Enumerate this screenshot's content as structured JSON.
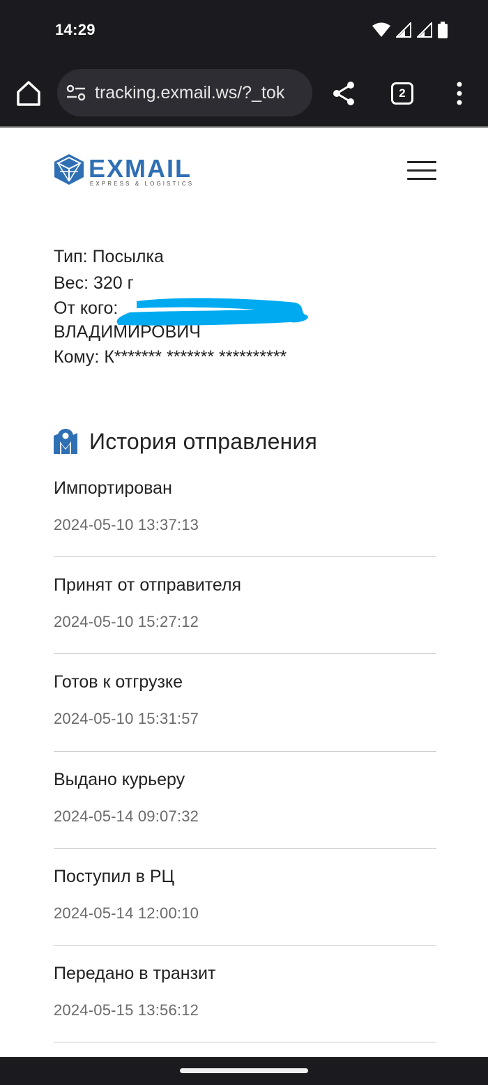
{
  "status_bar": {
    "time": "14:29",
    "icons": [
      "wifi-icon",
      "signal-icon",
      "signal-icon",
      "battery-icon"
    ]
  },
  "browser": {
    "url": "tracking.exmail.ws/?_tok",
    "tab_count": "2"
  },
  "brand": {
    "name": "EXMAIL",
    "tagline": "EXPRESS & LOGISTICS",
    "color": "#2f6fb4"
  },
  "parcel": {
    "type": "Тип: Посылка",
    "weight": "Вес: 320 г",
    "from_label": "От кого: ",
    "from_value_line2": "ВЛАДИМИРОВИЧ",
    "to": "Кому: К******* ******* **********"
  },
  "history": {
    "title": "История отправления",
    "events": [
      {
        "status": "Импортирован",
        "time": "2024-05-10 13:37:13"
      },
      {
        "status": "Принят от отправителя",
        "time": "2024-05-10 15:27:12"
      },
      {
        "status": "Готов к отгрузке",
        "time": "2024-05-10 15:31:57"
      },
      {
        "status": "Выдано курьеру",
        "time": "2024-05-14 09:07:32"
      },
      {
        "status": "Поступил в РЦ",
        "time": "2024-05-14 12:00:10"
      },
      {
        "status": "Передано в транзит",
        "time": "2024-05-15 13:56:12"
      }
    ]
  },
  "colors": {
    "accent": "#2f6fb4",
    "redaction": "#00aaf0",
    "chrome": "#1b1b1f"
  }
}
